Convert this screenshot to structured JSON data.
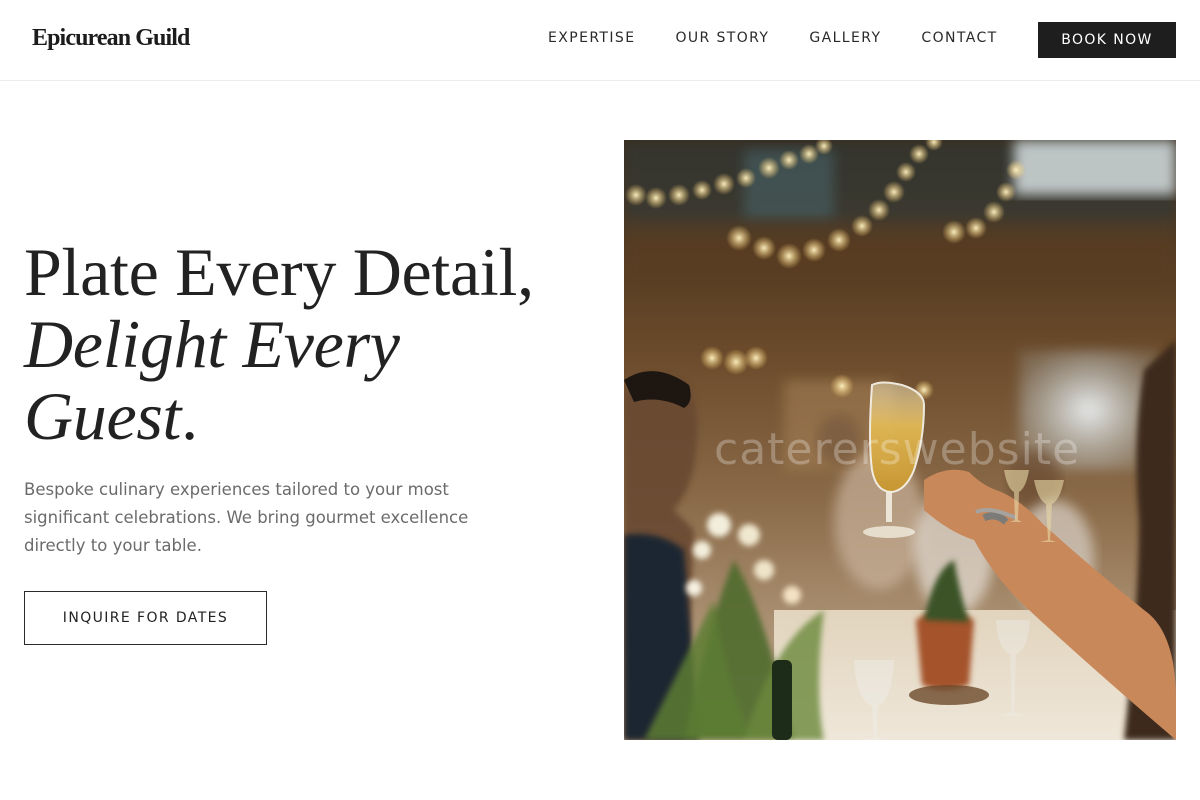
{
  "brand": {
    "name": "Epicurean Guild"
  },
  "nav": {
    "items": [
      {
        "label": "EXPERTISE"
      },
      {
        "label": "OUR STORY"
      },
      {
        "label": "GALLERY"
      },
      {
        "label": "CONTACT"
      }
    ],
    "cta": "BOOK NOW"
  },
  "hero": {
    "headline_line1": "Plate Every Detail,",
    "headline_line2": "Delight Every",
    "headline_line3": "Guest",
    "headline_period": ".",
    "subcopy": "Bespoke culinary experiences tailored to your most significant celebrations. We bring gourmet excellence directly to your table.",
    "cta": "INQUIRE FOR DATES",
    "photo_watermark": "catererswebsite"
  },
  "colors": {
    "ink": "#1e1e1e",
    "muted_text": "#6b6b6b",
    "divider": "#ececec",
    "bulb": "#ffd27a"
  }
}
